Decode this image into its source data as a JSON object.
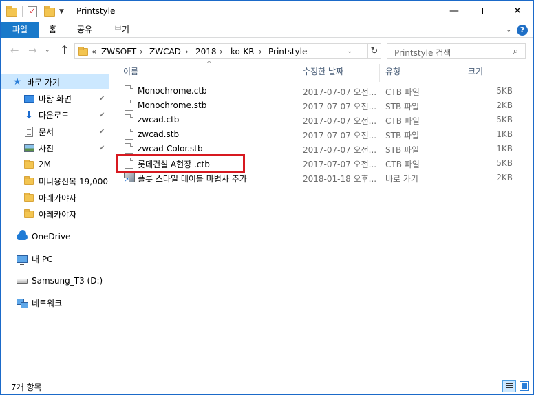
{
  "window": {
    "title": "Printstyle",
    "controls": {
      "minimize": "—",
      "maximize": "",
      "close": "✕"
    }
  },
  "ribbon": {
    "tabs": [
      "파일",
      "홈",
      "공유",
      "보기"
    ]
  },
  "address": {
    "overflow": "«",
    "breadcrumbs": [
      "ZWSOFT",
      "ZWCAD",
      "2018",
      "ko-KR",
      "Printstyle"
    ],
    "separator": "›"
  },
  "search": {
    "placeholder": "Printstyle 검색"
  },
  "sidebar": {
    "items": [
      {
        "label": "바로 가기",
        "icon": "star-icon"
      },
      {
        "label": "바탕 화면",
        "icon": "desktop-icon",
        "pinned": true
      },
      {
        "label": "다운로드",
        "icon": "download-icon",
        "pinned": true
      },
      {
        "label": "문서",
        "icon": "documents-icon",
        "pinned": true
      },
      {
        "label": "사진",
        "icon": "pictures-icon",
        "pinned": true
      },
      {
        "label": "2M",
        "icon": "folder-icon"
      },
      {
        "label": "미니용신목 19,000",
        "icon": "folder-icon"
      },
      {
        "label": "아레카야자",
        "icon": "folder-icon"
      },
      {
        "label": "아레카야자",
        "icon": "folder-icon"
      },
      {
        "label": "OneDrive",
        "icon": "onedrive-icon"
      },
      {
        "label": "내 PC",
        "icon": "pc-icon"
      },
      {
        "label": "Samsung_T3 (D:)",
        "icon": "drive-icon"
      },
      {
        "label": "네트워크",
        "icon": "network-icon"
      }
    ],
    "pin_glyph": "📌"
  },
  "columns": {
    "name": "이름",
    "date": "수정한 날짜",
    "type": "유형",
    "size": "크기",
    "sort_indicator": "^"
  },
  "files": [
    {
      "name": "Monochrome.ctb",
      "date": "2017-07-07 오전...",
      "type": "CTB 파일",
      "size": "5KB",
      "icon": "file-icon"
    },
    {
      "name": "Monochrome.stb",
      "date": "2017-07-07 오전...",
      "type": "STB 파일",
      "size": "2KB",
      "icon": "file-icon"
    },
    {
      "name": "zwcad.ctb",
      "date": "2017-07-07 오전...",
      "type": "CTB 파일",
      "size": "5KB",
      "icon": "file-icon"
    },
    {
      "name": "zwcad.stb",
      "date": "2017-07-07 오전...",
      "type": "STB 파일",
      "size": "1KB",
      "icon": "file-icon"
    },
    {
      "name": "zwcad-Color.stb",
      "date": "2017-07-07 오전...",
      "type": "STB 파일",
      "size": "1KB",
      "icon": "file-icon"
    },
    {
      "name": "롯데건설 A현장 .ctb",
      "date": "2017-07-07 오전...",
      "type": "CTB 파일",
      "size": "5KB",
      "icon": "file-icon"
    },
    {
      "name": "플롯 스타일 테이블 마법사 추가",
      "date": "2018-01-18 오후...",
      "type": "바로 가기",
      "size": "2KB",
      "icon": "shortcut-icon"
    }
  ],
  "status": {
    "count_text": "7개 항목"
  }
}
